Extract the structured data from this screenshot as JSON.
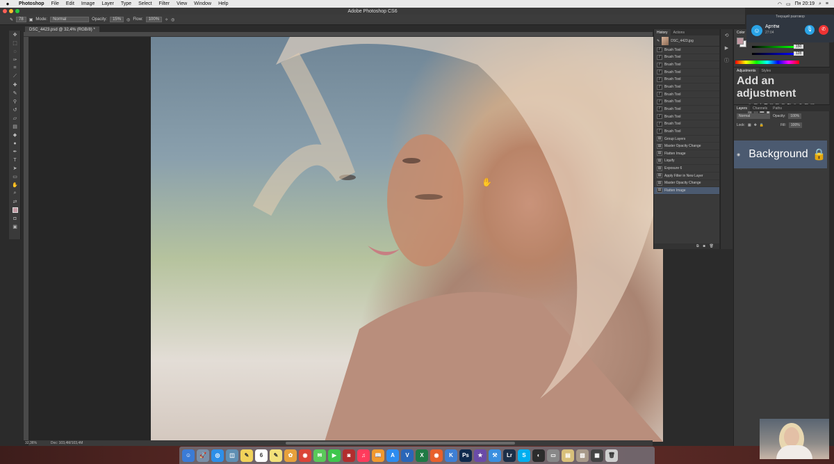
{
  "menubar": {
    "apple": "",
    "app": "Photoshop",
    "items": [
      "File",
      "Edit",
      "Image",
      "Layer",
      "Type",
      "Select",
      "Filter",
      "View",
      "Window",
      "Help"
    ],
    "clock": "Пн 20:19"
  },
  "window": {
    "title": "Adobe Photoshop CS6"
  },
  "options": {
    "mode_label": "Mode:",
    "mode_value": "Normal",
    "opacity_label": "Opacity:",
    "opacity_value": "15%",
    "flow_label": "Flow:",
    "flow_value": "100%",
    "brush_size": "78"
  },
  "document": {
    "tab": "DSC_4423.psd @ 32,4% (RGB/8) *",
    "zoom": "32,36%",
    "doc_size": "Doc: 103,4M/103,4M"
  },
  "history": {
    "tabs": [
      "History",
      "Actions"
    ],
    "snapshot": "DSC_4423.jpg",
    "items": [
      "Brush Tool",
      "Brush Tool",
      "Brush Tool",
      "Brush Tool",
      "Brush Tool",
      "Brush Tool",
      "Brush Tool",
      "Brush Tool",
      "Brush Tool",
      "Brush Tool",
      "Brush Tool",
      "Brush Tool",
      "Group Layers",
      "Master Opacity Change",
      "Flatten Image",
      "Liquify",
      "Exposure 6",
      "Apply Filter in New Layer",
      "Master Opacity Change",
      "Flatten Image"
    ]
  },
  "color_panel": {
    "tab": "Color",
    "r": "195",
    "g": "150",
    "b": "128"
  },
  "adjustments": {
    "tabs": [
      "Adjustments",
      "Styles"
    ],
    "heading": "Add an adjustment"
  },
  "layers": {
    "tabs": [
      "Layers",
      "Channels",
      "Paths"
    ],
    "blend": "Normal",
    "opacity_label": "Opacity:",
    "opacity": "100%",
    "lock_label": "Lock:",
    "fill_label": "Fill:",
    "fill": "100%",
    "layer_name": "Background"
  },
  "call": {
    "header": "Текущий разговор",
    "name": "Артём",
    "time": "27:04"
  },
  "dock_apps": [
    "Finder",
    "Launchpad",
    "Safari",
    "Preview",
    "Notes",
    "Calendar",
    "Stickies",
    "Photos",
    "Chrome",
    "Messages",
    "FaceTime",
    "Photo Booth",
    "iTunes",
    "iBooks",
    "App Store",
    "Vectorworks",
    "Excel",
    "Firefox",
    "Keynote",
    "Photoshop",
    "iMovie",
    "Xcode",
    "Lightroom",
    "Skype",
    "OBS",
    "Screenshot",
    "Folder",
    "Photos2",
    "Monitor",
    "Trash"
  ]
}
